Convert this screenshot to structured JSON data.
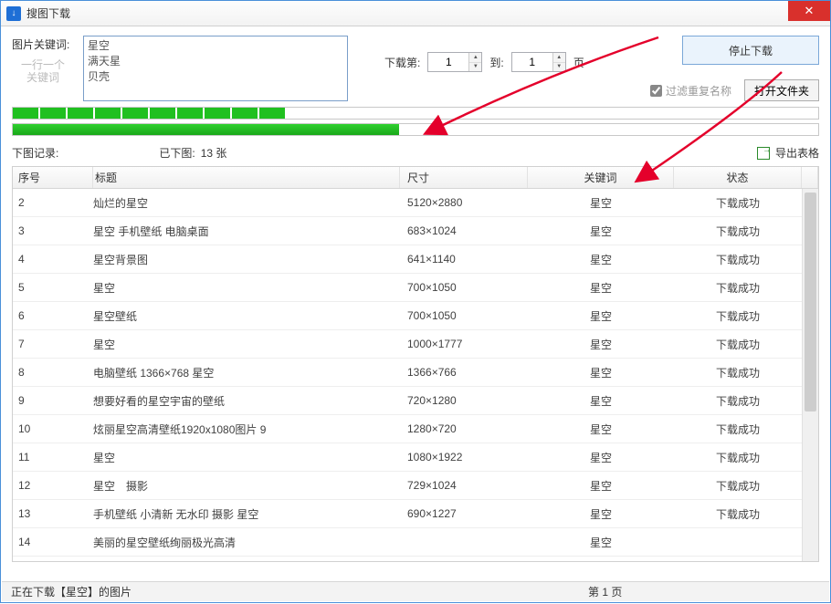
{
  "window": {
    "title": "搜图下载",
    "icon_glyph": "↓"
  },
  "top": {
    "keyword_label": "图片关键词:",
    "keyword_hint_line1": "一行一个",
    "keyword_hint_line2": "关键词",
    "keywords_text": "星空\n满天星\n贝壳",
    "page_from_label": "下载第:",
    "page_from_value": "1",
    "page_to_label": "到:",
    "page_to_value": "1",
    "page_unit": "页",
    "filter_dup_label": "过滤重复名称",
    "stop_btn": "停止下载",
    "open_folder_btn": "打开文件夹"
  },
  "progress": {
    "bar1_pct": 34,
    "bar2_pct": 48
  },
  "records": {
    "label": "下图记录:",
    "downloaded_label": "已下图:",
    "downloaded_value": "13 张",
    "export_label": "导出表格",
    "columns": {
      "idx": "序号",
      "title": "标题",
      "size": "尺寸",
      "kw": "关键词",
      "status": "状态"
    },
    "rows": [
      {
        "idx": "2",
        "title": "灿烂的星空",
        "size": "5120×2880",
        "kw": "星空",
        "status": "下载成功"
      },
      {
        "idx": "3",
        "title": "星空  手机壁纸  电脑桌面",
        "size": "683×1024",
        "kw": "星空",
        "status": "下载成功"
      },
      {
        "idx": "4",
        "title": "星空背景图",
        "size": "641×1140",
        "kw": "星空",
        "status": "下载成功"
      },
      {
        "idx": "5",
        "title": "星空",
        "size": "700×1050",
        "kw": "星空",
        "status": "下载成功"
      },
      {
        "idx": "6",
        "title": "星空壁纸",
        "size": "700×1050",
        "kw": "星空",
        "status": "下载成功"
      },
      {
        "idx": "7",
        "title": "星空",
        "size": "1000×1777",
        "kw": "星空",
        "status": "下载成功"
      },
      {
        "idx": "8",
        "title": "电脑壁纸 1366×768 星空",
        "size": "1366×766",
        "kw": "星空",
        "status": "下载成功"
      },
      {
        "idx": "9",
        "title": "想要好看的星空宇宙的壁纸",
        "size": "720×1280",
        "kw": "星空",
        "status": "下载成功"
      },
      {
        "idx": "10",
        "title": "炫丽星空高清壁纸1920x1080图片  9",
        "size": "1280×720",
        "kw": "星空",
        "status": "下载成功"
      },
      {
        "idx": "11",
        "title": "星空",
        "size": "1080×1922",
        "kw": "星空",
        "status": "下载成功"
      },
      {
        "idx": "12",
        "title": "星空　摄影",
        "size": "729×1024",
        "kw": "星空",
        "status": "下载成功"
      },
      {
        "idx": "13",
        "title": "手机壁纸 小清新 无水印  摄影  星空",
        "size": "690×1227",
        "kw": "星空",
        "status": "下载成功"
      },
      {
        "idx": "14",
        "title": "美丽的星空壁纸绚丽极光高清",
        "size": "",
        "kw": "星空",
        "status": ""
      }
    ]
  },
  "statusbar": {
    "left": "正在下载【星空】的图片",
    "mid": "第 1 页"
  }
}
